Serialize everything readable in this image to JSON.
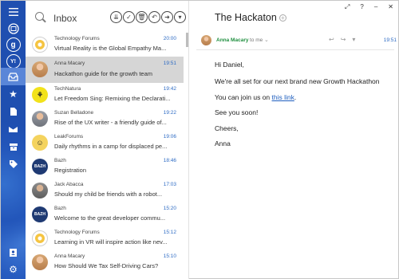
{
  "rail": {
    "accounts": [
      "g",
      "Y!"
    ],
    "buttons": [
      "menu-icon",
      "outlook-icon",
      "google-icon",
      "yahoo-icon",
      "inbox-icon",
      "star-icon",
      "document-icon",
      "mail-folder-icon",
      "archive-icon",
      "tag-icon",
      "contacts-icon",
      "settings-icon"
    ]
  },
  "list": {
    "folder": "Inbox",
    "toolbar": [
      "⇊",
      "✓",
      "🗑",
      "↶",
      "➜",
      "▾"
    ],
    "items": [
      {
        "sender": "Technology Forums",
        "time": "20:00",
        "subject": "Virtual Reality is the Global Empathy Ma...",
        "avatar": "forum",
        "mono": ""
      },
      {
        "sender": "Anna Macary",
        "time": "19:51",
        "subject": "Hackathon guide for the growth team",
        "avatar": "photo1",
        "mono": "",
        "selected": true
      },
      {
        "sender": "TechNatura",
        "time": "19:42",
        "subject": "Let Freedom Sing: Remixing the Declarati...",
        "avatar": "yellow",
        "mono": "⚘"
      },
      {
        "sender": "Suzan Belladone",
        "time": "19:22",
        "subject": "Rise of the UX writer - a friendly guide of...",
        "avatar": "photo2",
        "mono": ""
      },
      {
        "sender": "LeakForums",
        "time": "19:06",
        "subject": "Daily rhythms in a camp for displaced pe...",
        "avatar": "lego",
        "mono": "☺"
      },
      {
        "sender": "Bazh",
        "time": "18:46",
        "subject": "Registration",
        "avatar": "navy",
        "mono": "BAZH"
      },
      {
        "sender": "Jack Abacca",
        "time": "17:03",
        "subject": "Should my child be friends with a robot...",
        "avatar": "photo3",
        "mono": ""
      },
      {
        "sender": "Bazh",
        "time": "15:20",
        "subject": "Welcome to the great developer commu...",
        "avatar": "navy",
        "mono": "BAZH"
      },
      {
        "sender": "Technology Forums",
        "time": "15:12",
        "subject": "Learning in VR will inspire action like nev...",
        "avatar": "forum",
        "mono": ""
      },
      {
        "sender": "Anna Macary",
        "time": "15:10",
        "subject": "How Should We Tax Self-Driving Cars?",
        "avatar": "photo1",
        "mono": ""
      }
    ]
  },
  "pane": {
    "window_controls": [
      "⤢",
      "?",
      "–",
      "✕"
    ],
    "subject": "The Hackaton",
    "add_symbol": "+",
    "from_name": "Anna Macary",
    "to": "to me",
    "expand": "⌄",
    "actions": [
      "↩",
      "↪",
      "▾"
    ],
    "time": "19:51",
    "body": {
      "greeting": "Hi Daniel,",
      "line1": "We're all set for our next brand new Growth Hackathon",
      "line2_prefix": "You can join us on ",
      "link": "this link",
      "line2_suffix": ".",
      "line3": "See you soon!",
      "signoff": "Cheers,",
      "signature": "Anna"
    }
  }
}
